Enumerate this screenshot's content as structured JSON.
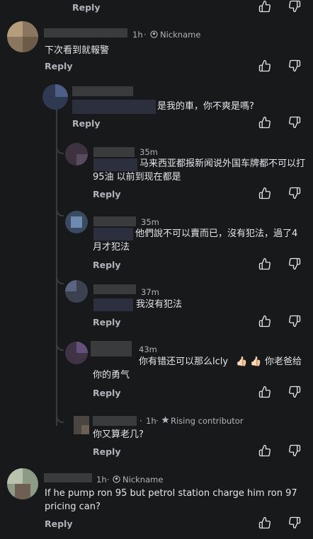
{
  "reply_label": "Reply",
  "top": {
    "reply": "Reply"
  },
  "comments": [
    {
      "time": "1h",
      "badge": "Nickname",
      "text": "下次看到就報警",
      "reply": "Reply"
    },
    {
      "time": "",
      "badge": "",
      "text": "是我的車，你不爽是嗎?",
      "reply": "Reply"
    },
    {
      "time": "35m",
      "badge": "",
      "text": "马来西亚都报新闻说外国车牌都不可以打95油 以前到现在都是",
      "reply": "Reply"
    },
    {
      "time": "35m",
      "badge": "",
      "text": "他們說不可以賣而已，沒有犯法，過了4月才犯法",
      "reply": "Reply"
    },
    {
      "time": "37m",
      "badge": "",
      "text": "我沒有犯法",
      "reply": "Reply"
    },
    {
      "time": "43m",
      "badge": "",
      "text_a": "你有错还可以那么lcly",
      "text_b": "你老爸给你的勇气",
      "reply": "Reply"
    },
    {
      "time": "1h",
      "badge": "Rising contributor",
      "text": "你又算老几?",
      "reply": "Reply"
    },
    {
      "time": "1h",
      "badge": "Nickname",
      "text": "If he pump ron 95 but petrol station charge him ron 97 pricing can?",
      "reply": "Reply"
    }
  ]
}
